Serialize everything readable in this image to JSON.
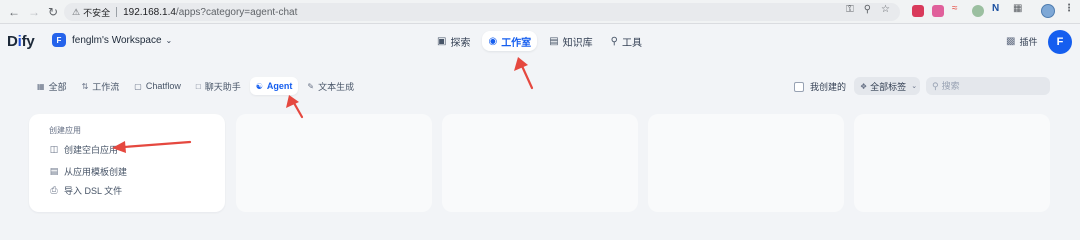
{
  "browser": {
    "insecure_label": "不安全",
    "url_host": "192.168.1.4",
    "url_path": "/apps?category=agent-chat",
    "back_icon": "back-arrow-icon",
    "forward_icon": "forward-arrow-icon",
    "reload_icon": "reload-icon"
  },
  "app": {
    "logo_prefix": "D",
    "logo_i": "i",
    "logo_suffix": "fy",
    "workspace_initial": "F",
    "workspace_name": "fenglm's Workspace"
  },
  "topnav": [
    {
      "label": "探索",
      "icon": "explore-icon"
    },
    {
      "label": "工作室",
      "icon": "studio-icon",
      "active": true
    },
    {
      "label": "知识库",
      "icon": "knowledge-icon"
    },
    {
      "label": "工具",
      "icon": "tools-icon"
    }
  ],
  "plugin_label": "插件",
  "user_initial": "F",
  "tabs": [
    {
      "label": "全部",
      "icon": "grid-icon"
    },
    {
      "label": "工作流",
      "icon": "workflow-icon"
    },
    {
      "label": "Chatflow",
      "icon": "chatflow-icon"
    },
    {
      "label": "聊天助手",
      "icon": "chat-icon"
    },
    {
      "label": "Agent",
      "icon": "agent-icon",
      "active": true
    },
    {
      "label": "文本生成",
      "icon": "text-gen-icon"
    }
  ],
  "filters": {
    "created_by_me": "我创建的",
    "all_tags": "全部标签",
    "search_placeholder": "搜索"
  },
  "create_card": {
    "title": "创建应用",
    "options": [
      "创建空白应用",
      "从应用模板创建",
      "导入 DSL 文件"
    ]
  },
  "colors": {
    "accent": "#155eef",
    "background": "#f2f4f7",
    "annotation_arrow": "#e5483f"
  }
}
